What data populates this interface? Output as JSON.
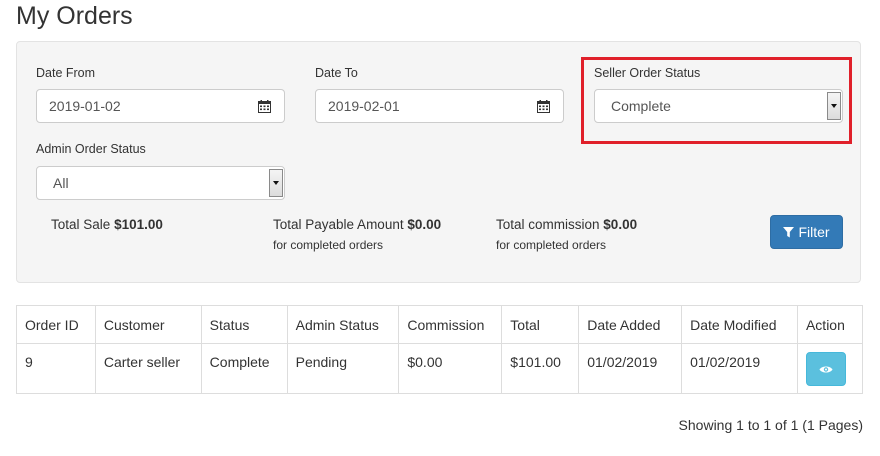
{
  "page": {
    "title": "My Orders"
  },
  "filters": {
    "date_from": {
      "label": "Date From",
      "value": "2019-01-02"
    },
    "date_to": {
      "label": "Date To",
      "value": "2019-02-01"
    },
    "seller_order_status": {
      "label": "Seller Order Status",
      "value": "Complete"
    },
    "admin_order_status": {
      "label": "Admin Order Status",
      "value": "All"
    },
    "filter_button_label": "Filter"
  },
  "summary": {
    "total_sale_label": "Total Sale",
    "total_sale_value": "$101.00",
    "total_payable_label": "Total Payable Amount",
    "total_payable_value": "$0.00",
    "total_payable_note": "for completed orders",
    "total_commission_label": "Total commission",
    "total_commission_value": "$0.00",
    "total_commission_note": "for completed orders"
  },
  "table": {
    "headers": [
      "Order ID",
      "Customer",
      "Status",
      "Admin Status",
      "Commission",
      "Total",
      "Date Added",
      "Date Modified",
      "Action"
    ],
    "rows": [
      {
        "order_id": "9",
        "customer": "Carter seller",
        "status": "Complete",
        "admin_status": "Pending",
        "commission": "$0.00",
        "total": "$101.00",
        "date_added": "01/02/2019",
        "date_modified": "01/02/2019",
        "action_icon": "eye-icon"
      }
    ]
  },
  "pagination": {
    "text": "Showing 1 to 1 of 1 (1 Pages)"
  },
  "colors": {
    "highlight": "#e0202a",
    "primary": "#337ab7",
    "info": "#5bc0de"
  }
}
